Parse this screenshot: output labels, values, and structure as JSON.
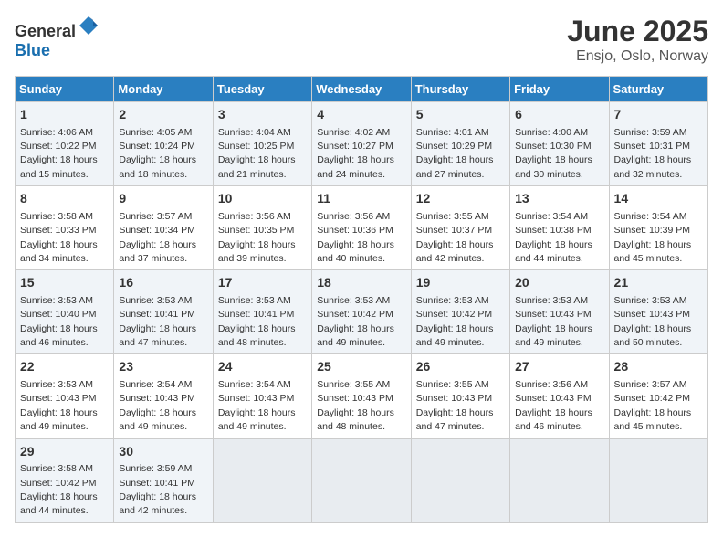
{
  "header": {
    "logo_general": "General",
    "logo_blue": "Blue",
    "title": "June 2025",
    "subtitle": "Ensjo, Oslo, Norway"
  },
  "days_of_week": [
    "Sunday",
    "Monday",
    "Tuesday",
    "Wednesday",
    "Thursday",
    "Friday",
    "Saturday"
  ],
  "weeks": [
    [
      {
        "day": "1",
        "sunrise": "Sunrise: 4:06 AM",
        "sunset": "Sunset: 10:22 PM",
        "daylight": "Daylight: 18 hours and 15 minutes."
      },
      {
        "day": "2",
        "sunrise": "Sunrise: 4:05 AM",
        "sunset": "Sunset: 10:24 PM",
        "daylight": "Daylight: 18 hours and 18 minutes."
      },
      {
        "day": "3",
        "sunrise": "Sunrise: 4:04 AM",
        "sunset": "Sunset: 10:25 PM",
        "daylight": "Daylight: 18 hours and 21 minutes."
      },
      {
        "day": "4",
        "sunrise": "Sunrise: 4:02 AM",
        "sunset": "Sunset: 10:27 PM",
        "daylight": "Daylight: 18 hours and 24 minutes."
      },
      {
        "day": "5",
        "sunrise": "Sunrise: 4:01 AM",
        "sunset": "Sunset: 10:29 PM",
        "daylight": "Daylight: 18 hours and 27 minutes."
      },
      {
        "day": "6",
        "sunrise": "Sunrise: 4:00 AM",
        "sunset": "Sunset: 10:30 PM",
        "daylight": "Daylight: 18 hours and 30 minutes."
      },
      {
        "day": "7",
        "sunrise": "Sunrise: 3:59 AM",
        "sunset": "Sunset: 10:31 PM",
        "daylight": "Daylight: 18 hours and 32 minutes."
      }
    ],
    [
      {
        "day": "8",
        "sunrise": "Sunrise: 3:58 AM",
        "sunset": "Sunset: 10:33 PM",
        "daylight": "Daylight: 18 hours and 34 minutes."
      },
      {
        "day": "9",
        "sunrise": "Sunrise: 3:57 AM",
        "sunset": "Sunset: 10:34 PM",
        "daylight": "Daylight: 18 hours and 37 minutes."
      },
      {
        "day": "10",
        "sunrise": "Sunrise: 3:56 AM",
        "sunset": "Sunset: 10:35 PM",
        "daylight": "Daylight: 18 hours and 39 minutes."
      },
      {
        "day": "11",
        "sunrise": "Sunrise: 3:56 AM",
        "sunset": "Sunset: 10:36 PM",
        "daylight": "Daylight: 18 hours and 40 minutes."
      },
      {
        "day": "12",
        "sunrise": "Sunrise: 3:55 AM",
        "sunset": "Sunset: 10:37 PM",
        "daylight": "Daylight: 18 hours and 42 minutes."
      },
      {
        "day": "13",
        "sunrise": "Sunrise: 3:54 AM",
        "sunset": "Sunset: 10:38 PM",
        "daylight": "Daylight: 18 hours and 44 minutes."
      },
      {
        "day": "14",
        "sunrise": "Sunrise: 3:54 AM",
        "sunset": "Sunset: 10:39 PM",
        "daylight": "Daylight: 18 hours and 45 minutes."
      }
    ],
    [
      {
        "day": "15",
        "sunrise": "Sunrise: 3:53 AM",
        "sunset": "Sunset: 10:40 PM",
        "daylight": "Daylight: 18 hours and 46 minutes."
      },
      {
        "day": "16",
        "sunrise": "Sunrise: 3:53 AM",
        "sunset": "Sunset: 10:41 PM",
        "daylight": "Daylight: 18 hours and 47 minutes."
      },
      {
        "day": "17",
        "sunrise": "Sunrise: 3:53 AM",
        "sunset": "Sunset: 10:41 PM",
        "daylight": "Daylight: 18 hours and 48 minutes."
      },
      {
        "day": "18",
        "sunrise": "Sunrise: 3:53 AM",
        "sunset": "Sunset: 10:42 PM",
        "daylight": "Daylight: 18 hours and 49 minutes."
      },
      {
        "day": "19",
        "sunrise": "Sunrise: 3:53 AM",
        "sunset": "Sunset: 10:42 PM",
        "daylight": "Daylight: 18 hours and 49 minutes."
      },
      {
        "day": "20",
        "sunrise": "Sunrise: 3:53 AM",
        "sunset": "Sunset: 10:43 PM",
        "daylight": "Daylight: 18 hours and 49 minutes."
      },
      {
        "day": "21",
        "sunrise": "Sunrise: 3:53 AM",
        "sunset": "Sunset: 10:43 PM",
        "daylight": "Daylight: 18 hours and 50 minutes."
      }
    ],
    [
      {
        "day": "22",
        "sunrise": "Sunrise: 3:53 AM",
        "sunset": "Sunset: 10:43 PM",
        "daylight": "Daylight: 18 hours and 49 minutes."
      },
      {
        "day": "23",
        "sunrise": "Sunrise: 3:54 AM",
        "sunset": "Sunset: 10:43 PM",
        "daylight": "Daylight: 18 hours and 49 minutes."
      },
      {
        "day": "24",
        "sunrise": "Sunrise: 3:54 AM",
        "sunset": "Sunset: 10:43 PM",
        "daylight": "Daylight: 18 hours and 49 minutes."
      },
      {
        "day": "25",
        "sunrise": "Sunrise: 3:55 AM",
        "sunset": "Sunset: 10:43 PM",
        "daylight": "Daylight: 18 hours and 48 minutes."
      },
      {
        "day": "26",
        "sunrise": "Sunrise: 3:55 AM",
        "sunset": "Sunset: 10:43 PM",
        "daylight": "Daylight: 18 hours and 47 minutes."
      },
      {
        "day": "27",
        "sunrise": "Sunrise: 3:56 AM",
        "sunset": "Sunset: 10:43 PM",
        "daylight": "Daylight: 18 hours and 46 minutes."
      },
      {
        "day": "28",
        "sunrise": "Sunrise: 3:57 AM",
        "sunset": "Sunset: 10:42 PM",
        "daylight": "Daylight: 18 hours and 45 minutes."
      }
    ],
    [
      {
        "day": "29",
        "sunrise": "Sunrise: 3:58 AM",
        "sunset": "Sunset: 10:42 PM",
        "daylight": "Daylight: 18 hours and 44 minutes."
      },
      {
        "day": "30",
        "sunrise": "Sunrise: 3:59 AM",
        "sunset": "Sunset: 10:41 PM",
        "daylight": "Daylight: 18 hours and 42 minutes."
      },
      null,
      null,
      null,
      null,
      null
    ]
  ]
}
